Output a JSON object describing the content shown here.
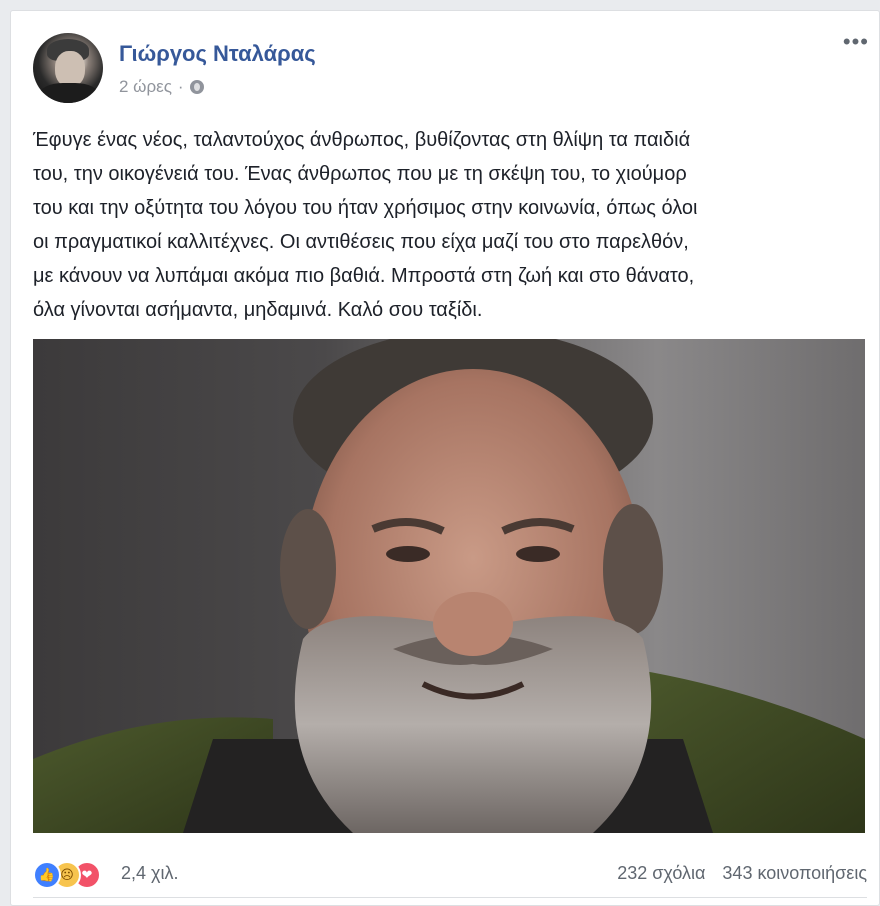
{
  "post": {
    "author": "Γιώργος Νταλάρας",
    "time": "2 ώρες",
    "separator": "·",
    "privacy_icon": "globe-icon",
    "more_label": "•••",
    "text_lines": [
      "Έφυγε ένας νέος, ταλαντούχος άνθρωπος, βυθίζοντας στη θλίψη τα παιδιά",
      "του, την οικογένειά του. Ένας άνθρωπος που με τη σκέψη του, το χιούμορ",
      "του και την οξύτητα του λόγου του ήταν χρήσιμος στην κοινωνία, όπως όλοι",
      "οι πραγματικοί καλλιτέχνες. Οι αντιθέσεις που είχα μαζί του στο παρελθόν,",
      "με κάνουν να λυπάμαι ακόμα πιο βαθιά. Μπροστά στη ζωή και στο θάνατο,",
      "όλα γίνονται ασήμαντα, μηδαμινά. Καλό σου ταξίδι."
    ]
  },
  "stats": {
    "reactions": [
      "like-icon",
      "sad-icon",
      "love-icon"
    ],
    "reaction_count": "2,4 χιλ.",
    "comments": "232 σχόλια",
    "shares": "343 κοινοποιήσεις"
  },
  "colors": {
    "author": "#365899",
    "like": "#4080ff",
    "sad": "#f7c44e",
    "love": "#f25268",
    "meta": "#90949c"
  }
}
